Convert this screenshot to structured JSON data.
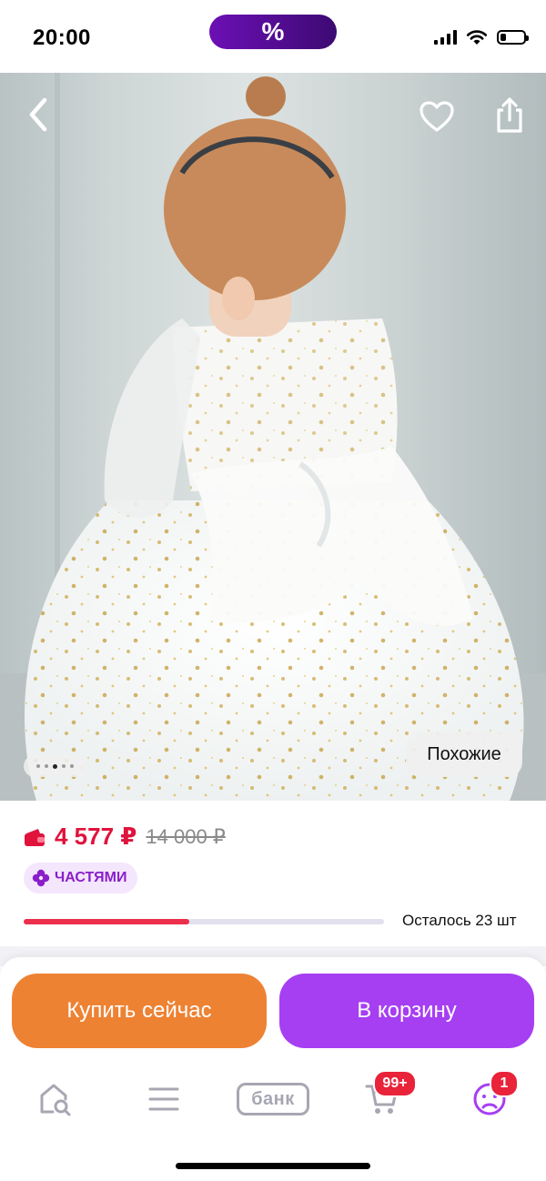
{
  "status_bar": {
    "time": "20:00",
    "promo_symbol": "%",
    "icons": [
      "signal-icon",
      "wifi-icon",
      "battery-icon"
    ]
  },
  "product_gallery": {
    "icons": [
      "back-arrow-icon",
      "heart-icon",
      "share-icon"
    ],
    "similar_label": "Похожие",
    "page_count": 5,
    "active_page": 3
  },
  "price": {
    "current": "4 577 ₽",
    "old": "14 000 ₽",
    "installments_label": "ЧАСТЯМИ",
    "stock_label": "Осталось 23 шт",
    "stock_fraction": 0.46,
    "colors": {
      "price": "#e0133c",
      "stock_bar": "#ec2f4b",
      "installments": "#8a1fc9"
    }
  },
  "actions": {
    "buy_now": "Купить сейчас",
    "add_to_cart": "В корзину",
    "colors": {
      "buy_now": "#ee8233",
      "add_to_cart": "#a63ef2"
    }
  },
  "tabbar": {
    "icons": [
      "home-search-icon",
      "catalog-menu-icon",
      "bank-icon",
      "cart-icon",
      "profile-icon"
    ],
    "bank_label": "банк",
    "cart_badge": "99+",
    "profile_badge": "1"
  }
}
